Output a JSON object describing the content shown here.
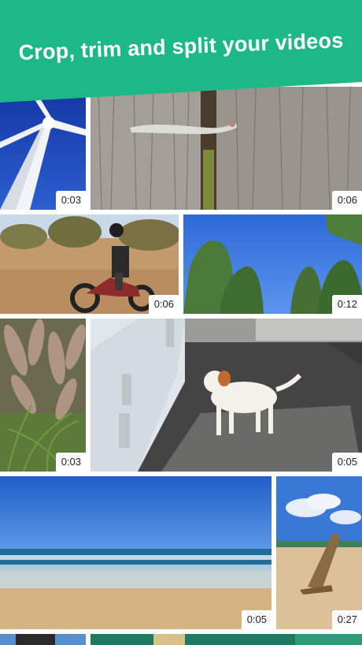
{
  "banner": {
    "title": "Crop, trim and split your videos"
  },
  "colors": {
    "accent": "#1db887"
  },
  "tiles": [
    {
      "name": "wind-turbine",
      "duration": "0:03"
    },
    {
      "name": "lizard-on-bench",
      "duration": "0:06"
    },
    {
      "name": "motorbike-rider",
      "duration": "0:06"
    },
    {
      "name": "trees-sky",
      "duration": "0:12"
    },
    {
      "name": "grass-plumes",
      "duration": "0:03"
    },
    {
      "name": "dog-on-balcony",
      "duration": "0:05"
    },
    {
      "name": "ocean-beach",
      "duration": "0:05"
    },
    {
      "name": "beach-driftwood",
      "duration": "0:27"
    },
    {
      "name": "partial-bottom-left",
      "duration": ""
    },
    {
      "name": "partial-bottom-right",
      "duration": ""
    }
  ]
}
